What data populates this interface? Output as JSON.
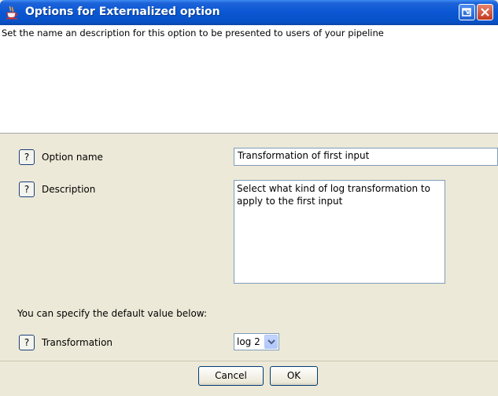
{
  "window": {
    "title": "Options for Externalized option"
  },
  "header": {
    "text": "Set the name an description for this option to be presented to users of your pipeline"
  },
  "fields": {
    "option_name": {
      "help_label": "?",
      "label": "Option name",
      "value": "Transformation of first input"
    },
    "description": {
      "help_label": "?",
      "label": "Description",
      "value": "Select what kind of log transformation to apply to the first input"
    },
    "default_hint": "You can specify the default value below:",
    "transformation": {
      "help_label": "?",
      "label": "Transformation",
      "selected": "log 2"
    }
  },
  "buttons": {
    "cancel": "Cancel",
    "ok": "OK"
  },
  "colors": {
    "title_bar": "#0a57d3",
    "dialog_bg": "#ece9d8",
    "field_border": "#7f9db9"
  }
}
